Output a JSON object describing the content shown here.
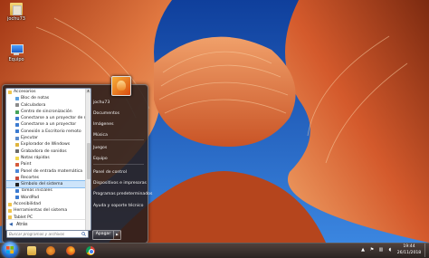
{
  "desktop": {
    "icons": [
      {
        "label": "jochu73"
      },
      {
        "label": "Equipo"
      }
    ]
  },
  "start_menu": {
    "programs": [
      {
        "label": "Accesorios",
        "type": "folder-open"
      },
      {
        "label": "Bloc de notas"
      },
      {
        "label": "Calculadora"
      },
      {
        "label": "Centro de sincronización"
      },
      {
        "label": "Conectarse a un proyector de red"
      },
      {
        "label": "Conectarse a un proyector"
      },
      {
        "label": "Conexión a Escritorio remoto"
      },
      {
        "label": "Ejecutar"
      },
      {
        "label": "Explorador de Windows"
      },
      {
        "label": "Grabadora de sonidos"
      },
      {
        "label": "Notas rápidas"
      },
      {
        "label": "Paint"
      },
      {
        "label": "Panel de entrada matemática"
      },
      {
        "label": "Recortes"
      },
      {
        "label": "Símbolo del sistema"
      },
      {
        "label": "Tareas iniciales"
      },
      {
        "label": "WordPad"
      },
      {
        "label": "Accesibilidad",
        "type": "folder"
      },
      {
        "label": "Herramientas del sistema",
        "type": "folder"
      },
      {
        "label": "Tablet PC",
        "type": "folder"
      }
    ],
    "selected_index": 14,
    "back_label": "Atrás",
    "search_placeholder": "Buscar programas y archivos",
    "right_items": [
      {
        "label": "jochu73"
      },
      {
        "label": "Documentos"
      },
      {
        "label": "Imágenes"
      },
      {
        "label": "Música"
      },
      {
        "label": "Juegos"
      },
      {
        "label": "Equipo"
      },
      {
        "label": "Panel de control"
      },
      {
        "label": "Dispositivos e impresoras"
      },
      {
        "label": "Programas predeterminados"
      },
      {
        "label": "Ayuda y soporte técnico"
      }
    ],
    "shutdown_label": "Apagar",
    "shutdown_arrow": "▶"
  },
  "taskbar": {
    "clock_time": "19:44",
    "clock_date": "26/11/2018",
    "tray_up_arrow": "▲",
    "tray_flag": "⚑",
    "tray_network": "▥",
    "tray_volume": "◖"
  },
  "colors": {
    "accent": "#2a78d8",
    "selected_bg": "#cde4fa"
  }
}
